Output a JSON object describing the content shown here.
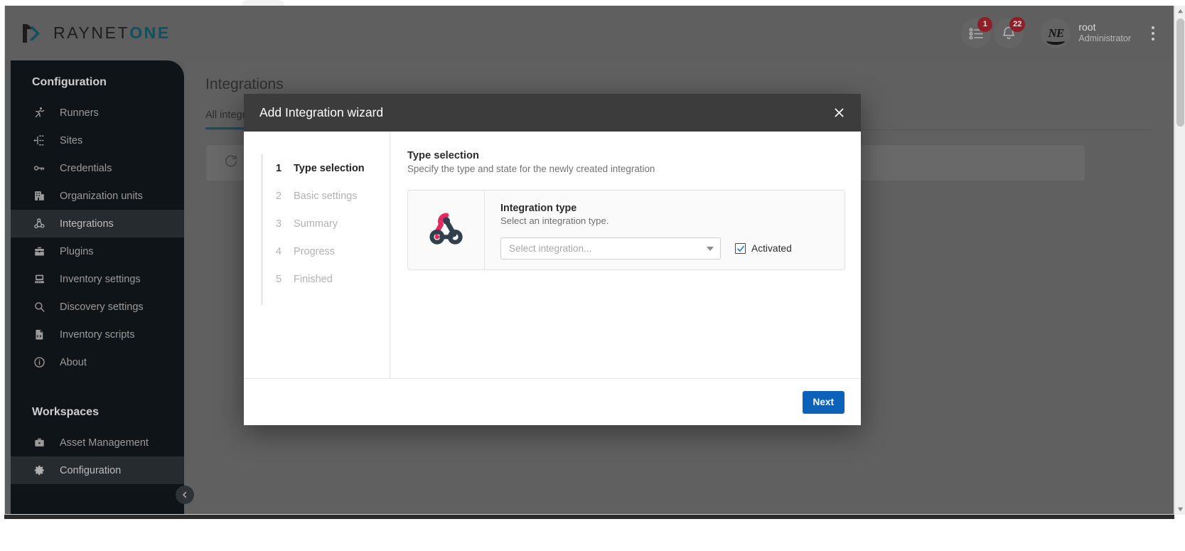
{
  "brand": {
    "name_dark": "RAYNET",
    "name_accent": "ONE"
  },
  "topbar": {
    "tasks_icon": "list-tasks-icon",
    "tasks_badge": "1",
    "notifications_icon": "bell-icon",
    "notifications_badge": "22",
    "avatar_text": "NE",
    "user_name": "root",
    "user_role": "Administrator",
    "overflow_icon": "kebab-menu-icon"
  },
  "sidebar": {
    "section_configuration": "Configuration",
    "section_workspaces": "Workspaces",
    "collapse_icon": "chevron-left-icon",
    "items": [
      {
        "label": "Runners",
        "icon": "runner-icon",
        "active": false
      },
      {
        "label": "Sites",
        "icon": "sitemap-icon",
        "active": false
      },
      {
        "label": "Credentials",
        "icon": "key-icon",
        "active": false
      },
      {
        "label": "Organization units",
        "icon": "building-icon",
        "active": false
      },
      {
        "label": "Integrations",
        "icon": "webhook-icon",
        "active": true
      },
      {
        "label": "Plugins",
        "icon": "toolbox-icon",
        "active": false
      },
      {
        "label": "Inventory settings",
        "icon": "server-icon",
        "active": false
      },
      {
        "label": "Discovery settings",
        "icon": "search-icon",
        "active": false
      },
      {
        "label": "Inventory scripts",
        "icon": "file-script-icon",
        "active": false
      },
      {
        "label": "About",
        "icon": "info-circle-icon",
        "active": false
      }
    ],
    "workspace_items": [
      {
        "label": "Asset Management",
        "icon": "briefcase-icon",
        "active": false
      },
      {
        "label": "Configuration",
        "icon": "gear-icon",
        "active": true
      }
    ]
  },
  "page": {
    "title": "Integrations",
    "tab_label": "All integrations",
    "refresh_icon": "refresh-icon"
  },
  "modal": {
    "title": "Add Integration wizard",
    "close_icon": "close-icon",
    "steps": [
      {
        "num": "1",
        "label": "Type selection",
        "active": true
      },
      {
        "num": "2",
        "label": "Basic settings",
        "active": false
      },
      {
        "num": "3",
        "label": "Summary",
        "active": false
      },
      {
        "num": "4",
        "label": "Progress",
        "active": false
      },
      {
        "num": "5",
        "label": "Finished",
        "active": false
      }
    ],
    "pane": {
      "title": "Type selection",
      "subtitle": "Specify the type and state for the newly created integration"
    },
    "type_card": {
      "icon": "webhook-icon",
      "title": "Integration type",
      "subtitle": "Select an integration type.",
      "select_placeholder": "Select integration...",
      "select_caret_icon": "chevron-down-icon",
      "checkbox_label": "Activated",
      "checkbox_checked": true
    },
    "next_label": "Next"
  },
  "colors": {
    "brand_accent": "#13505f",
    "primary_button": "#0c62b8",
    "badge_red": "#8c1f28",
    "webhook_pink": "#e5285f",
    "webhook_dark": "#31404d",
    "sidebar_bg": "#0f1419",
    "topbar_bg": "#5f5f5f",
    "modal_header_bg": "#3c3c3c"
  },
  "scrollbar": {
    "up_icon": "triangle-up-icon",
    "down_icon": "triangle-down-icon"
  }
}
